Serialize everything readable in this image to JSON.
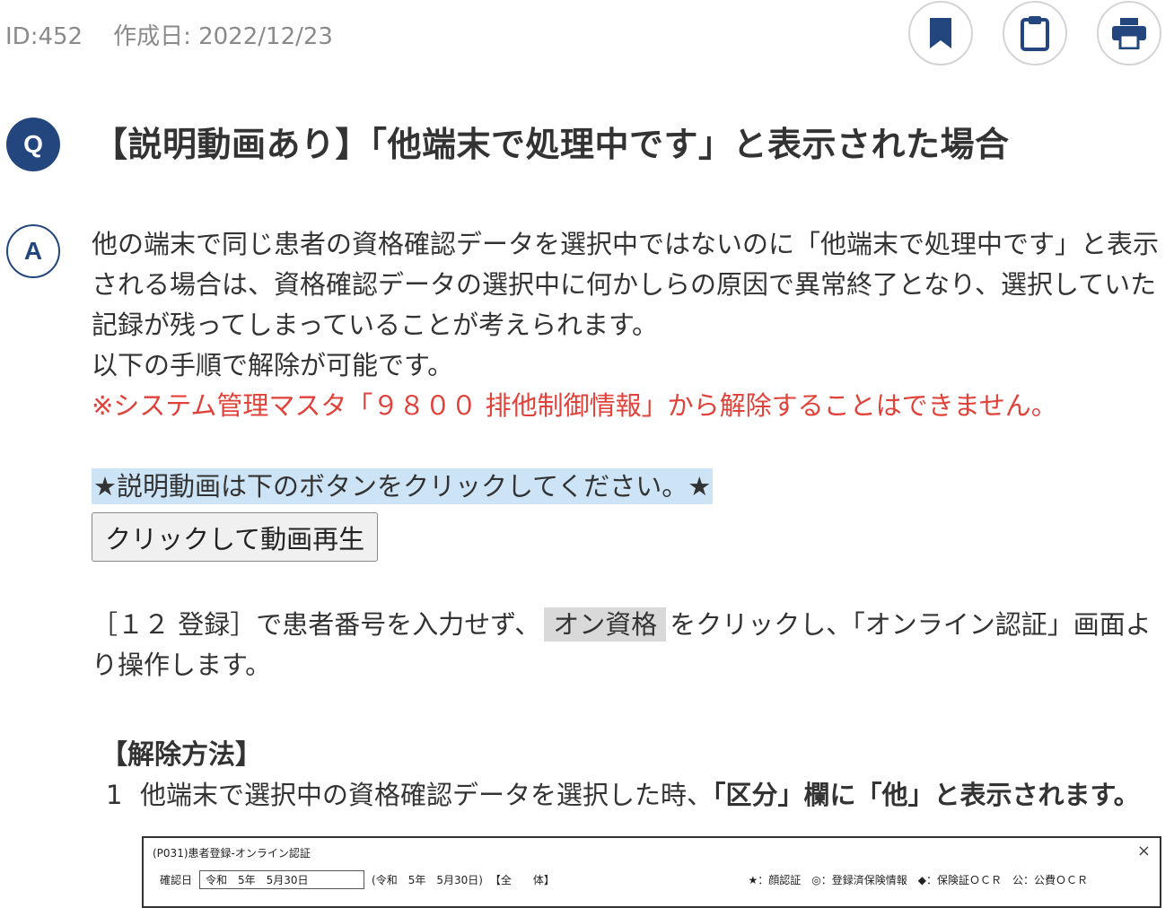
{
  "meta": {
    "id": "ID:452",
    "created": "作成日: 2022/12/23"
  },
  "icons": {
    "bookmark": "bookmark-icon",
    "clipboard": "clipboard-icon",
    "print": "print-icon"
  },
  "colors": {
    "accent": "#24467f",
    "warning": "#e0423a",
    "highlight": "#cde4f7"
  },
  "question": {
    "badge": "Q",
    "title": "【説明動画あり】「他端末で処理中です」と表示された場合"
  },
  "answer": {
    "badge": "A",
    "para1": "他の端末で同じ患者の資格確認データを選択中ではないのに「他端末で処理中です」と表示される場合は、資格確認データの選択中に何かしらの原因で異常終了となり、選択していた記録が残ってしまっていることが考えられます。",
    "para1b": "以下の手順で解除が可能です。",
    "warning": "※システム管理マスタ「９８００ 排他制御情報」から解除することはできません。",
    "video_note": "★説明動画は下のボタンをクリックしてください。★",
    "video_button": "クリックして動画再生",
    "para2_before": "［１２ 登録］で患者番号を入力せず、",
    "para2_button": "オン資格",
    "para2_after": "をクリックし、「オンライン認証」画面より操作します。",
    "section_title": "【解除方法】",
    "steps": [
      {
        "num": "1",
        "text_plain": "他端末で選択中の資格確認データを選択した時、",
        "text_bold": "「区分」欄に「他」と表示されます。"
      }
    ]
  },
  "screenshot": {
    "title": "(P031)患者登録-オンライン認証",
    "close": "×",
    "date_label": "確認日",
    "date_value": "令和　5年　5月30日",
    "date_paren": "(令和　5年　5月30日)",
    "scope": "【全　　体】",
    "legend": "★：顔認証　◎：登録済保険情報　◆：保険証ＯＣＲ　公：公費ＯＣＲ"
  }
}
